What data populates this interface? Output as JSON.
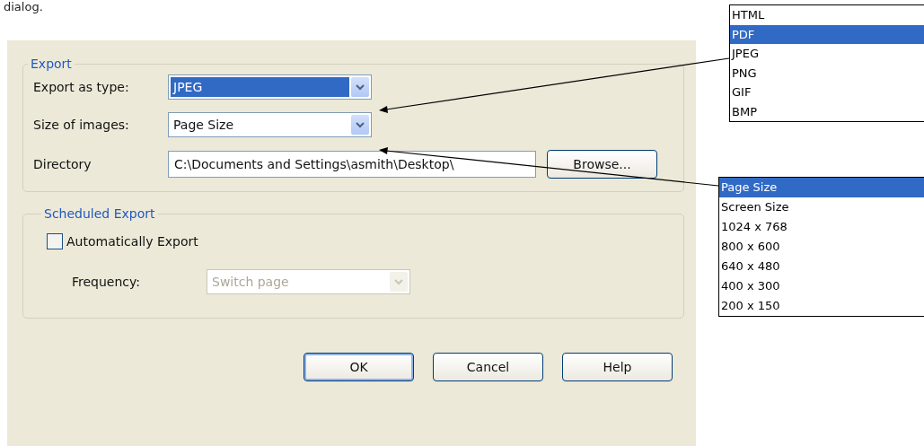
{
  "caption": "dialog.",
  "dialog": {
    "export_group": {
      "title": "Export",
      "fields": [
        {
          "kind": "dropdown",
          "label": "Export as type:",
          "value": "JPEG",
          "highlighted": true
        },
        {
          "kind": "dropdown",
          "label": "Size of images:",
          "value": "Page Size",
          "highlighted": false
        },
        {
          "kind": "path",
          "label": "Directory",
          "value": "C:\\Documents and Settings\\asmith\\Desktop\\",
          "button": "Browse..."
        }
      ]
    },
    "scheduled_group": {
      "title": "Scheduled Export",
      "checkbox": {
        "label": "Automatically Export",
        "checked": false
      },
      "frequency": {
        "label": "Frequency:",
        "value": "Switch page",
        "disabled": true
      }
    },
    "buttons": [
      {
        "label": "OK",
        "default": true
      },
      {
        "label": "Cancel",
        "default": false
      },
      {
        "label": "Help",
        "default": false
      }
    ]
  },
  "option_lists": [
    {
      "options": [
        {
          "label": "HTML",
          "selected": false
        },
        {
          "label": "PDF",
          "selected": true
        },
        {
          "label": "JPEG",
          "selected": false
        },
        {
          "label": "PNG",
          "selected": false
        },
        {
          "label": "GIF",
          "selected": false
        },
        {
          "label": "BMP",
          "selected": false
        }
      ]
    },
    {
      "options": [
        {
          "label": "Page Size",
          "selected": true
        },
        {
          "label": "Screen Size",
          "selected": false
        },
        {
          "label": "1024 x 768",
          "selected": false
        },
        {
          "label": "800 x 600",
          "selected": false
        },
        {
          "label": "640 x 480",
          "selected": false
        },
        {
          "label": "400 x 300",
          "selected": false
        },
        {
          "label": "200 x 150",
          "selected": false
        }
      ]
    }
  ]
}
